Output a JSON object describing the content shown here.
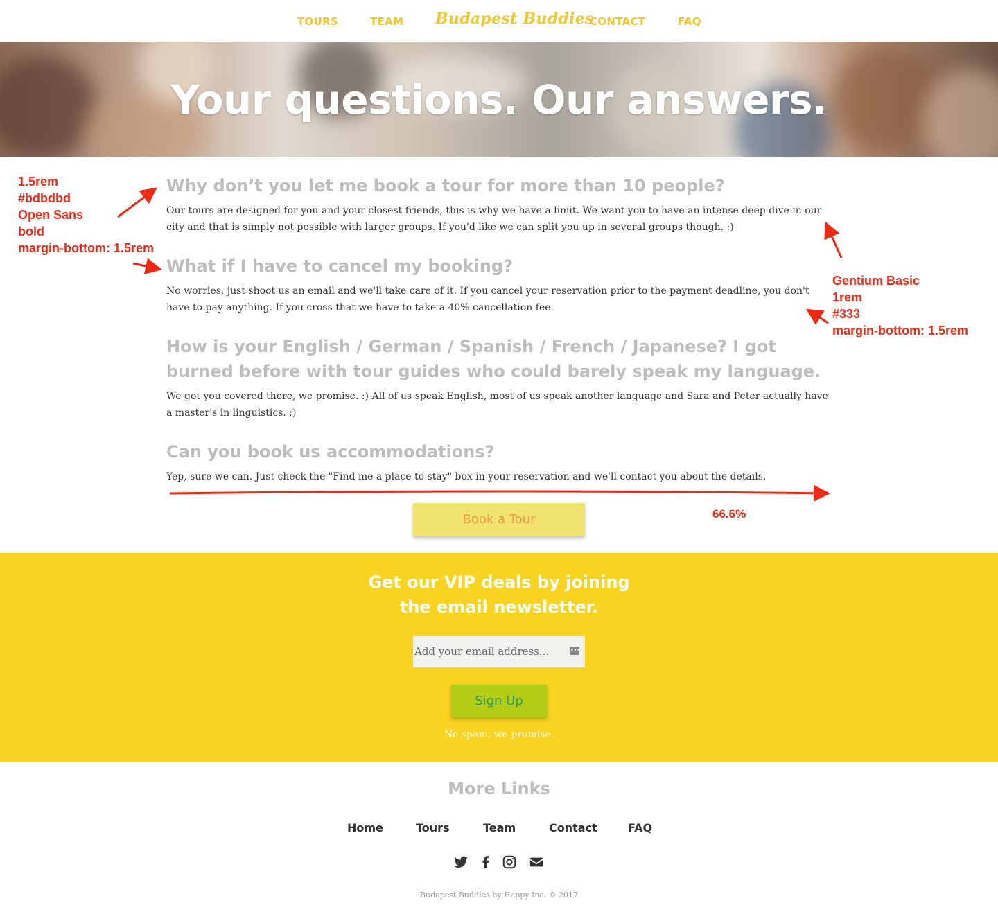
{
  "nav": {
    "items": [
      {
        "label": "TOURS"
      },
      {
        "label": "TEAM"
      },
      {
        "label": "Budapest Buddies"
      },
      {
        "label": "CONTACT"
      },
      {
        "label": "FAQ"
      }
    ]
  },
  "hero": {
    "title": "Your questions. Our answers."
  },
  "faq": [
    {
      "question": "Why don’t you let me book a tour for more than 10 people?",
      "answer": "Our tours are designed for you and your closest friends, this is why we have a limit. We want you to have an intense deep dive in our city and that is simply not possible with larger groups. If you'd like we can split you up in several groups though. :)"
    },
    {
      "question": "What if I have to cancel my booking?",
      "answer": "No worries, just shoot us an email and we'll take care of it. If you cancel your reservation prior to the payment deadline, you don't have to pay anything. If you cross that we have to take a 40% cancellation fee."
    },
    {
      "question": "How is your English / German / Spanish / French / Japanese? I got burned before with tour guides who could barely speak my language.",
      "answer": "We got you covered there, we promise. :) All of us speak English, most of us speak another language and Sara and Peter actually have a master's in linguistics. ;)"
    },
    {
      "question": "Can you book us accommodations?",
      "answer": "Yep, sure we can. Just check the \"Find me a place to stay\" box in your reservation and we'll contact you about the details."
    }
  ],
  "book_button": "Book a Tour",
  "annotations": {
    "heading_spec": [
      "1.5rem",
      "#bdbdbd",
      "Open Sans",
      "bold",
      "margin-bottom: 1.5rem"
    ],
    "body_spec": [
      "Gentium Basic",
      "1rem",
      "#333",
      "margin-bottom: 1.5rem"
    ],
    "width_spec": "66.6%"
  },
  "newsletter": {
    "title_line1": "Get our VIP deals by joining",
    "title_line2": "the email newsletter.",
    "email_placeholder": "Add your email address...",
    "signup_label": "Sign Up",
    "note": "No spam, we promise."
  },
  "footer": {
    "heading": "More Links",
    "links": [
      "Home",
      "Tours",
      "Team",
      "Contact",
      "FAQ"
    ],
    "social_icons": [
      "twitter-icon",
      "facebook-icon",
      "instagram-icon",
      "envelope-icon"
    ],
    "copyright": "Budapest Buddies by Happy Inc. © 2017"
  },
  "colors": {
    "accent_yellow": "#f8d421",
    "nav_yellow": "#f3c62b",
    "heading_gray": "#bdbdbd",
    "body_text": "#333333",
    "annotation_red": "#ee2a17",
    "signup_green": "#b3cc15"
  }
}
